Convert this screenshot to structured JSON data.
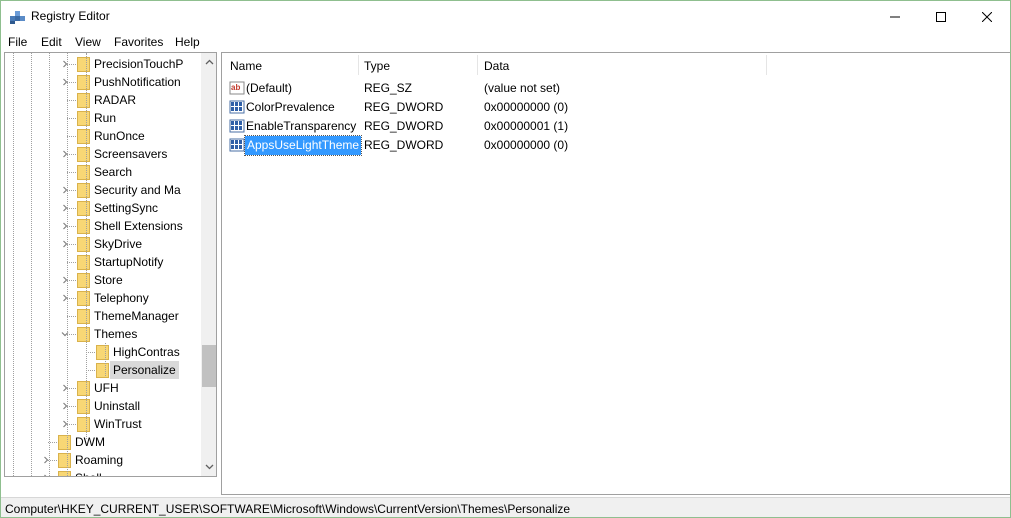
{
  "window": {
    "title": "Registry Editor"
  },
  "menu": [
    "File",
    "Edit",
    "View",
    "Favorites",
    "Help"
  ],
  "tree": {
    "items": [
      {
        "label": "PrecisionTouchP",
        "indent": 2,
        "expander": "collapsed"
      },
      {
        "label": "PushNotification",
        "indent": 2,
        "expander": "collapsed"
      },
      {
        "label": "RADAR",
        "indent": 2,
        "expander": "none"
      },
      {
        "label": "Run",
        "indent": 2,
        "expander": "none"
      },
      {
        "label": "RunOnce",
        "indent": 2,
        "expander": "none"
      },
      {
        "label": "Screensavers",
        "indent": 2,
        "expander": "collapsed"
      },
      {
        "label": "Search",
        "indent": 2,
        "expander": "none"
      },
      {
        "label": "Security and Ma",
        "indent": 2,
        "expander": "collapsed"
      },
      {
        "label": "SettingSync",
        "indent": 2,
        "expander": "collapsed"
      },
      {
        "label": "Shell Extensions",
        "indent": 2,
        "expander": "collapsed"
      },
      {
        "label": "SkyDrive",
        "indent": 2,
        "expander": "collapsed"
      },
      {
        "label": "StartupNotify",
        "indent": 2,
        "expander": "none"
      },
      {
        "label": "Store",
        "indent": 2,
        "expander": "collapsed"
      },
      {
        "label": "Telephony",
        "indent": 2,
        "expander": "collapsed"
      },
      {
        "label": "ThemeManager",
        "indent": 2,
        "expander": "none"
      },
      {
        "label": "Themes",
        "indent": 2,
        "expander": "expanded"
      },
      {
        "label": "HighContras",
        "indent": 3,
        "expander": "none"
      },
      {
        "label": "Personalize",
        "indent": 3,
        "expander": "none",
        "selected": true
      },
      {
        "label": "UFH",
        "indent": 2,
        "expander": "collapsed"
      },
      {
        "label": "Uninstall",
        "indent": 2,
        "expander": "collapsed"
      },
      {
        "label": "WinTrust",
        "indent": 2,
        "expander": "collapsed"
      },
      {
        "label": "DWM",
        "indent": 1,
        "expander": "none"
      },
      {
        "label": "Roaming",
        "indent": 1,
        "expander": "collapsed"
      },
      {
        "label": "Shell",
        "indent": 1,
        "expander": "collapsed"
      }
    ]
  },
  "list": {
    "columns": [
      "Name",
      "Type",
      "Data"
    ],
    "rows": [
      {
        "name": "(Default)",
        "type": "REG_SZ",
        "data": "(value not set)",
        "icon": "string-value-icon"
      },
      {
        "name": "ColorPrevalence",
        "type": "REG_DWORD",
        "data": "0x00000000 (0)",
        "icon": "dword-value-icon"
      },
      {
        "name": "EnableTransparency",
        "type": "REG_DWORD",
        "data": "0x00000001 (1)",
        "icon": "dword-value-icon"
      },
      {
        "name": "AppsUseLightTheme",
        "type": "REG_DWORD",
        "data": "0x00000000 (0)",
        "icon": "dword-value-icon",
        "selected": true
      }
    ]
  },
  "status": {
    "path": "Computer\\HKEY_CURRENT_USER\\SOFTWARE\\Microsoft\\Windows\\CurrentVersion\\Themes\\Personalize"
  },
  "colors": {
    "selection": "#3399ff",
    "folder": "#f8d775",
    "tree_selection": "#d9d9d9"
  }
}
